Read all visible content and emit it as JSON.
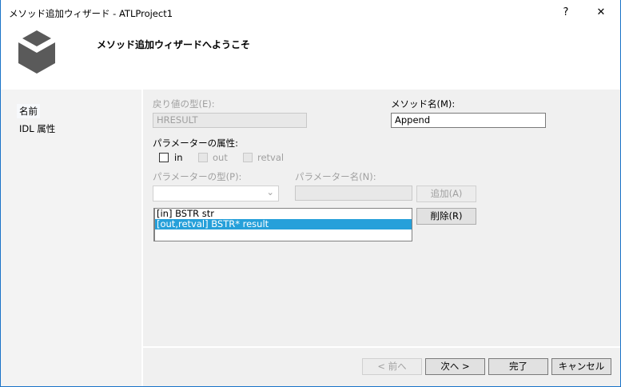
{
  "window": {
    "title": "メソッド追加ウィザード - ATLProject1",
    "help": "?",
    "close": "✕"
  },
  "header": {
    "title": "メソッド追加ウィザードへようこそ",
    "icon": "cube-icon"
  },
  "nav": {
    "items": [
      {
        "label": "名前"
      },
      {
        "label": "IDL 属性"
      }
    ]
  },
  "form": {
    "return_type_label": "戻り値の型(E):",
    "return_type_value": "HRESULT",
    "method_name_label": "メソッド名(M):",
    "method_name_value": "Append",
    "param_attr_label": "パラメーターの属性:",
    "attr_in": "in",
    "attr_out": "out",
    "attr_retval": "retval",
    "param_type_label": "パラメーターの型(P):",
    "param_type_value": "",
    "param_name_label": "パラメーター名(N):",
    "param_name_value": "",
    "add_button": "追加(A)",
    "remove_button": "削除(R)",
    "params": [
      {
        "text": "[in] BSTR str",
        "selected": false
      },
      {
        "text": "[out,retval] BSTR* result",
        "selected": true
      }
    ]
  },
  "footer": {
    "prev": "< 前へ",
    "next": "次へ >",
    "finish": "完了",
    "cancel": "キャンセル"
  },
  "colors": {
    "accent": "#26a0da",
    "border": "#1a73c8"
  }
}
